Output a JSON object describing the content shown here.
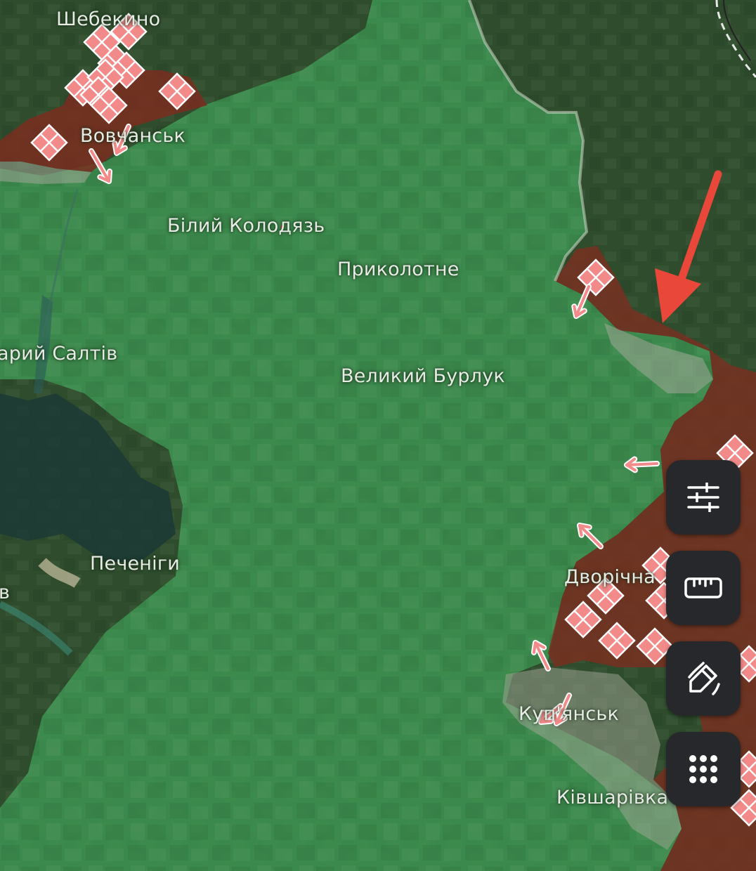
{
  "map": {
    "places": [
      {
        "id": "shebekino",
        "label": "Шебекино"
      },
      {
        "id": "vovchansk",
        "label": "Вовчанськ"
      },
      {
        "id": "bilyi-kolodiaz",
        "label": "Білий Колодязь"
      },
      {
        "id": "prykolotne",
        "label": "Приколотне"
      },
      {
        "id": "staryi-saltiv",
        "label": "арий Салтів"
      },
      {
        "id": "velykyi-burluk",
        "label": "Великий Бурлук"
      },
      {
        "id": "pechenihy",
        "label": "Печеніги"
      },
      {
        "id": "left-edge",
        "label": "в"
      },
      {
        "id": "dvorichna",
        "label": "Дворічна"
      },
      {
        "id": "kupiansk",
        "label": "Куп'янськ"
      },
      {
        "id": "kivsharivka",
        "label": "Ківшарівка"
      }
    ],
    "colors": {
      "ukraine_area": "#3f9a55",
      "occupied_area": "#7a2e20",
      "contested_area": "#9a9a8a",
      "marker": "#f28a8a",
      "annotation_arrow": "#e8473a"
    }
  },
  "controls": [
    {
      "id": "filters",
      "icon": "sliders-icon"
    },
    {
      "id": "measure",
      "icon": "ruler-icon"
    },
    {
      "id": "draw",
      "icon": "pencil-icon"
    },
    {
      "id": "grid",
      "icon": "grid-dots-icon"
    }
  ]
}
